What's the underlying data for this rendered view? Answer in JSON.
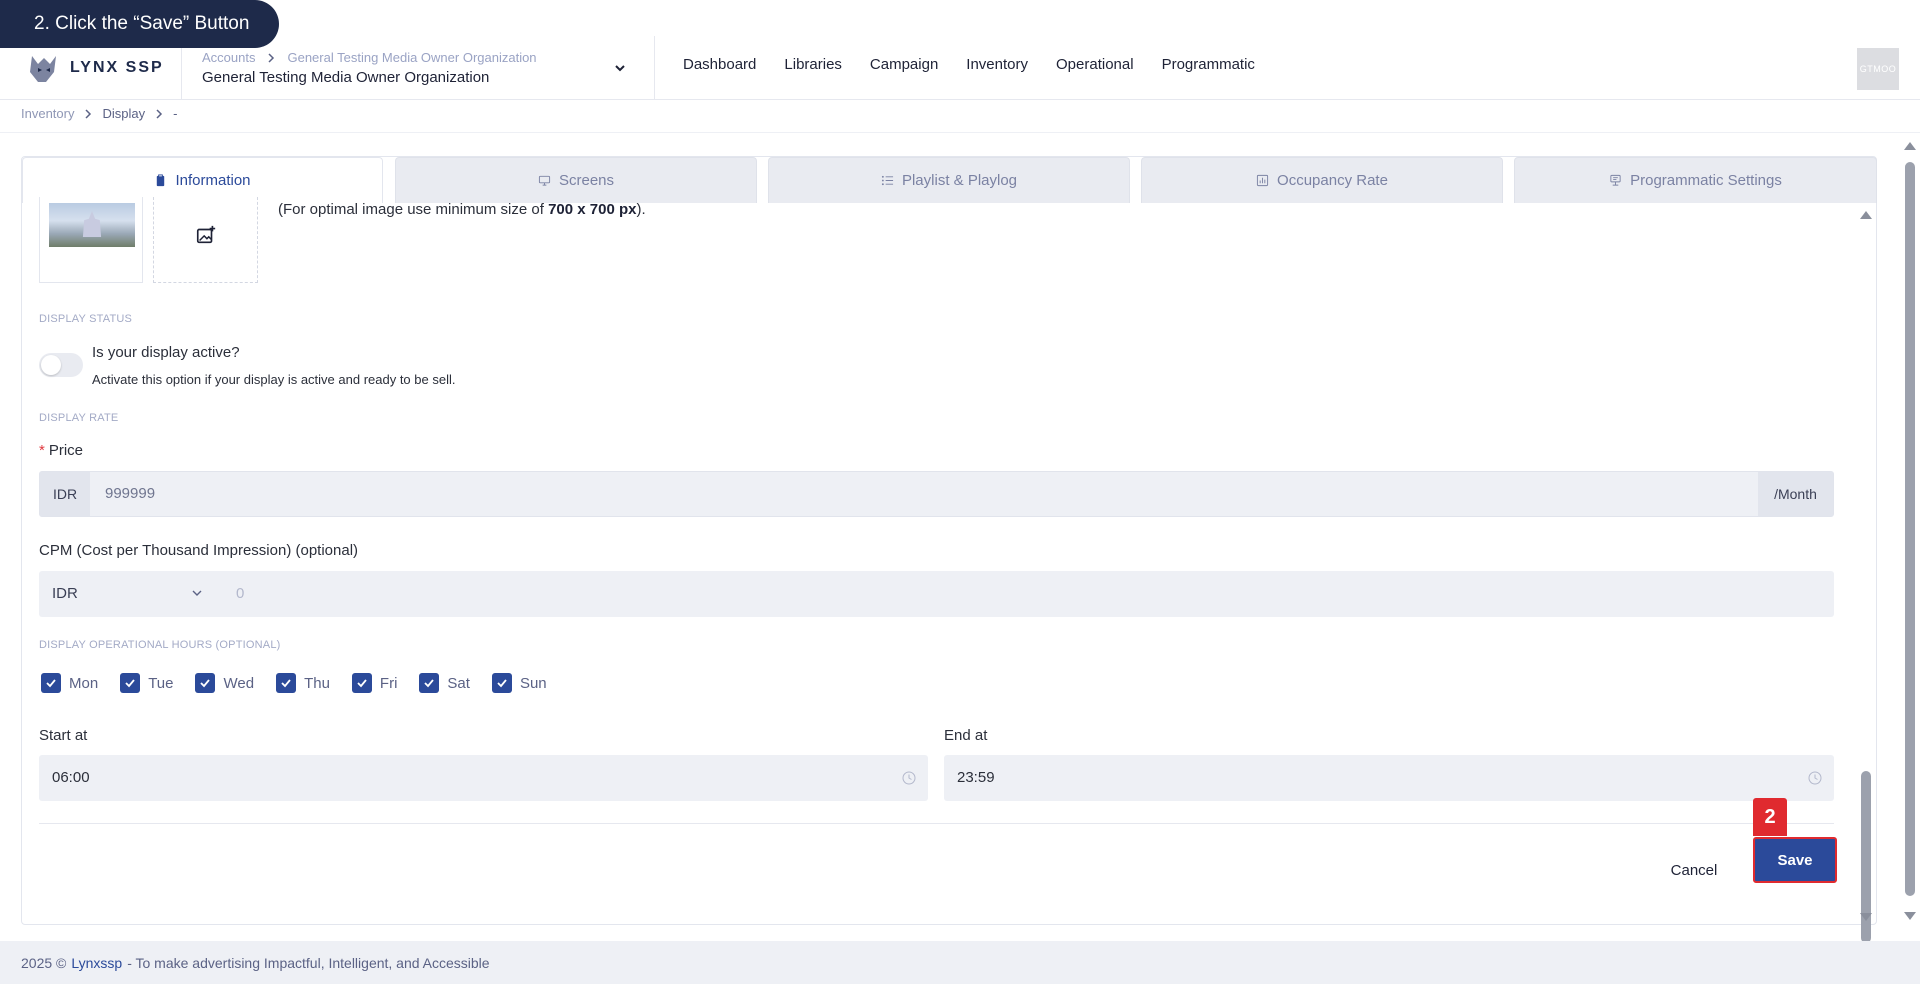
{
  "tutorial": {
    "step_text": "2. Click the “Save” Button",
    "step_number": "2"
  },
  "header": {
    "logo_text": "LYNX SSP",
    "org_crumbs": [
      "Accounts",
      "General Testing Media Owner Organization"
    ],
    "org_name": "General Testing Media Owner Organization",
    "nav": [
      "Dashboard",
      "Libraries",
      "Campaign",
      "Inventory",
      "Operational",
      "Programmatic"
    ],
    "avatar": "GTMOO"
  },
  "breadcrumb": [
    "Inventory",
    "Display",
    "-"
  ],
  "tabs": [
    {
      "label": "Information",
      "icon": "clipboard-icon",
      "active": true
    },
    {
      "label": "Screens",
      "icon": "monitor-icon",
      "active": false
    },
    {
      "label": "Playlist & Playlog",
      "icon": "list-icon",
      "active": false
    },
    {
      "label": "Occupancy Rate",
      "icon": "chart-icon",
      "active": false
    },
    {
      "label": "Programmatic Settings",
      "icon": "settings-icon",
      "active": false
    }
  ],
  "image": {
    "hint_prefix": "(For optimal image use minimum size of ",
    "hint_size": "700 x 700 px",
    "hint_suffix": ")."
  },
  "display_status": {
    "section": "DISPLAY STATUS",
    "question": "Is your display active?",
    "description": "Activate this option if your display is active and ready to be sell.",
    "active": false
  },
  "display_rate": {
    "section": "DISPLAY RATE",
    "price_label": "Price",
    "required_mark": "*",
    "currency": "IDR",
    "price_value": "999999",
    "price_suffix": "/Month",
    "cpm_label": "CPM (Cost per Thousand Impression) (optional)",
    "cpm_currency": "IDR",
    "cpm_placeholder": "0"
  },
  "hours": {
    "section": "DISPLAY OPERATIONAL HOURS (OPTIONAL)",
    "days": [
      "Mon",
      "Tue",
      "Wed",
      "Thu",
      "Fri",
      "Sat",
      "Sun"
    ],
    "start_label": "Start at",
    "start_value": "06:00",
    "end_label": "End at",
    "end_value": "23:59"
  },
  "actions": {
    "cancel": "Cancel",
    "save": "Save"
  },
  "footer": {
    "prefix": "2025 ©",
    "brand": "Lynxssp",
    "tagline": "- To make advertising Impactful, Intelligent, and Accessible"
  },
  "colors": {
    "primary": "#2b4a9a",
    "highlight": "#e02a2f",
    "navy": "#1e2a4a"
  }
}
